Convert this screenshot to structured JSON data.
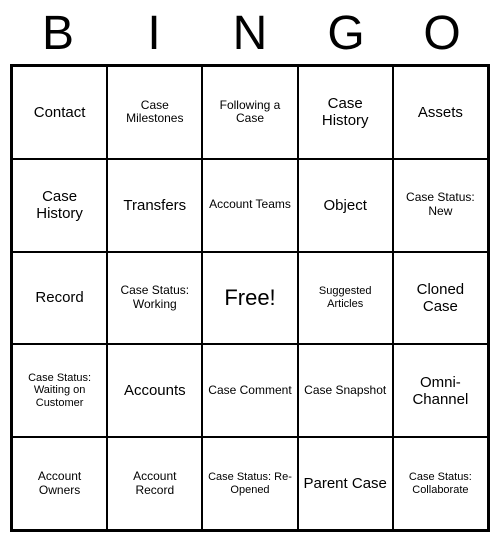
{
  "header": [
    "B",
    "I",
    "N",
    "G",
    "O"
  ],
  "cells": [
    [
      "Contact",
      "Case Milestones",
      "Following a Case",
      "Case History",
      "Assets"
    ],
    [
      "Case History",
      "Transfers",
      "Account Teams",
      "Object",
      "Case Status: New"
    ],
    [
      "Record",
      "Case Status: Working",
      "Free!",
      "Suggested Articles",
      "Cloned Case"
    ],
    [
      "Case Status: Waiting on Customer",
      "Accounts",
      "Case Comment",
      "Case Snapshot",
      "Omni-Channel"
    ],
    [
      "Account Owners",
      "Account Record",
      "Case Status: Re-Opened",
      "Parent Case",
      "Case Status: Collaborate"
    ]
  ],
  "sizes": [
    [
      "",
      "small",
      "small",
      "",
      ""
    ],
    [
      "",
      "",
      "small",
      "",
      "small"
    ],
    [
      "",
      "small",
      "free",
      "xsmall",
      ""
    ],
    [
      "xsmall",
      "",
      "small",
      "small",
      ""
    ],
    [
      "small",
      "small",
      "xsmall",
      "",
      "xsmall"
    ]
  ]
}
